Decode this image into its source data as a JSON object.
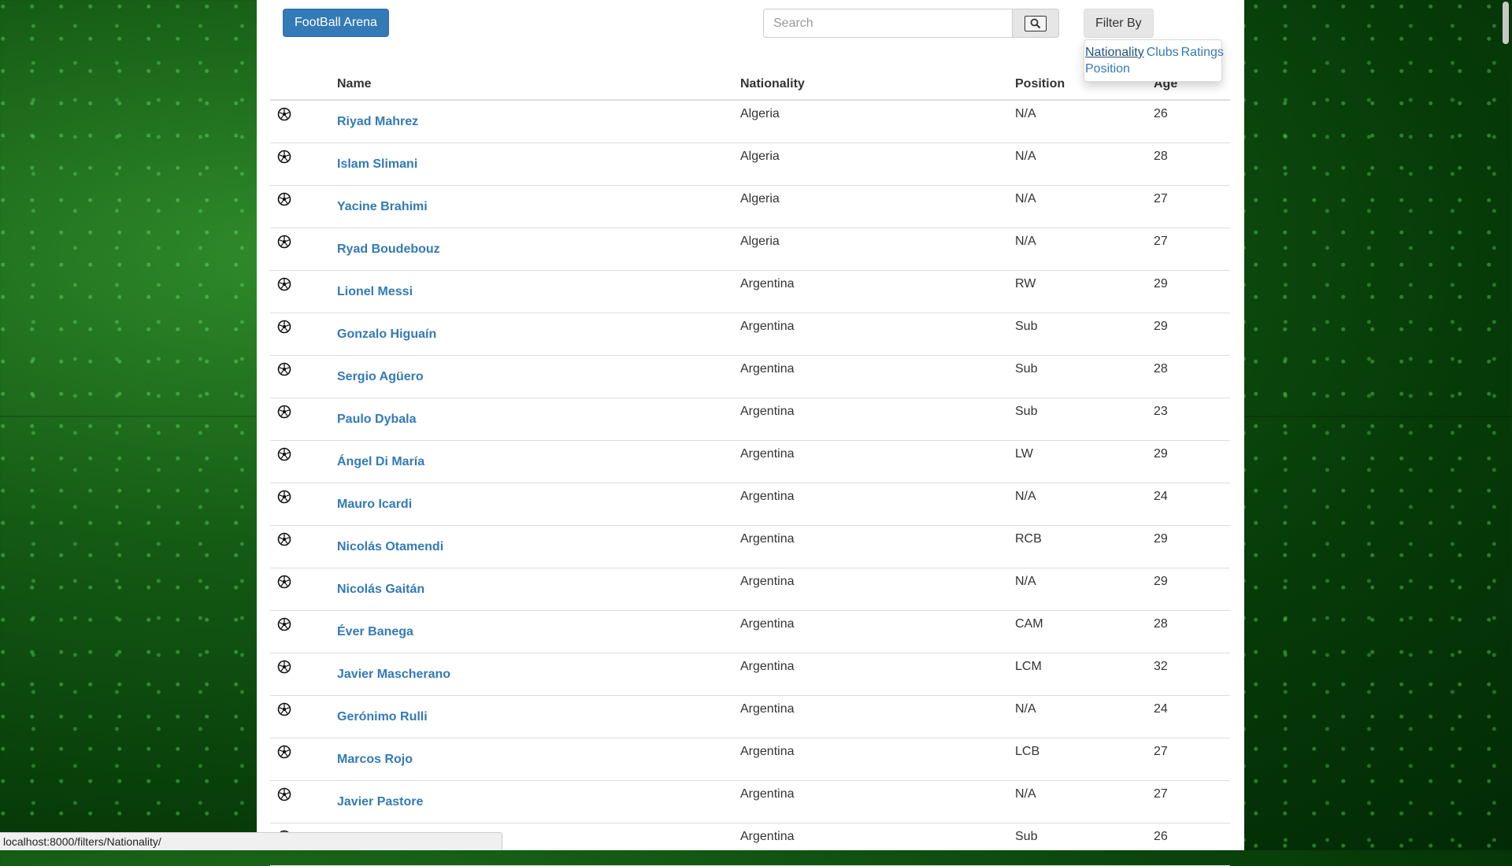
{
  "navbar": {
    "brand": "FootBall Arena"
  },
  "search": {
    "placeholder": "Search",
    "button_icon": "search-icon"
  },
  "filter": {
    "button_label": "Filter By",
    "options": [
      {
        "label": "Nationality",
        "active": true
      },
      {
        "label": "Clubs",
        "active": false
      },
      {
        "label": "Ratings",
        "active": false
      },
      {
        "label": "Position",
        "active": false
      }
    ]
  },
  "table": {
    "headers": [
      "",
      "Name",
      "Nationality",
      "Position",
      "Age"
    ],
    "row_icon": "soccer-ball-icon",
    "rows": [
      {
        "name": "Riyad Mahrez",
        "nationality": "Algeria",
        "position": "N/A",
        "age": "26"
      },
      {
        "name": "Islam Slimani",
        "nationality": "Algeria",
        "position": "N/A",
        "age": "28"
      },
      {
        "name": "Yacine Brahimi",
        "nationality": "Algeria",
        "position": "N/A",
        "age": "27"
      },
      {
        "name": "Ryad Boudebouz",
        "nationality": "Algeria",
        "position": "N/A",
        "age": "27"
      },
      {
        "name": "Lionel Messi",
        "nationality": "Argentina",
        "position": "RW",
        "age": "29"
      },
      {
        "name": "Gonzalo Higuaín",
        "nationality": "Argentina",
        "position": "Sub",
        "age": "29"
      },
      {
        "name": "Sergio Agüero",
        "nationality": "Argentina",
        "position": "Sub",
        "age": "28"
      },
      {
        "name": "Paulo Dybala",
        "nationality": "Argentina",
        "position": "Sub",
        "age": "23"
      },
      {
        "name": "Ángel Di María",
        "nationality": "Argentina",
        "position": "LW",
        "age": "29"
      },
      {
        "name": "Mauro Icardi",
        "nationality": "Argentina",
        "position": "N/A",
        "age": "24"
      },
      {
        "name": "Nicolás Otamendi",
        "nationality": "Argentina",
        "position": "RCB",
        "age": "29"
      },
      {
        "name": "Nicolás Gaitán",
        "nationality": "Argentina",
        "position": "N/A",
        "age": "29"
      },
      {
        "name": "Éver Banega",
        "nationality": "Argentina",
        "position": "CAM",
        "age": "28"
      },
      {
        "name": "Javier Mascherano",
        "nationality": "Argentina",
        "position": "LCM",
        "age": "32"
      },
      {
        "name": "Gerónimo Rulli",
        "nationality": "Argentina",
        "position": "N/A",
        "age": "24"
      },
      {
        "name": "Marcos Rojo",
        "nationality": "Argentina",
        "position": "LCB",
        "age": "27"
      },
      {
        "name": "Javier Pastore",
        "nationality": "Argentina",
        "position": "N/A",
        "age": "27"
      },
      {
        "name": "",
        "nationality": "Argentina",
        "position": "Sub",
        "age": "26"
      }
    ]
  },
  "status_bar": {
    "url": "localhost:8000/filters/Nationality/"
  },
  "colors": {
    "link": "#337ab7",
    "brand_button": "#337ab7",
    "background": "#0b4a0b"
  }
}
